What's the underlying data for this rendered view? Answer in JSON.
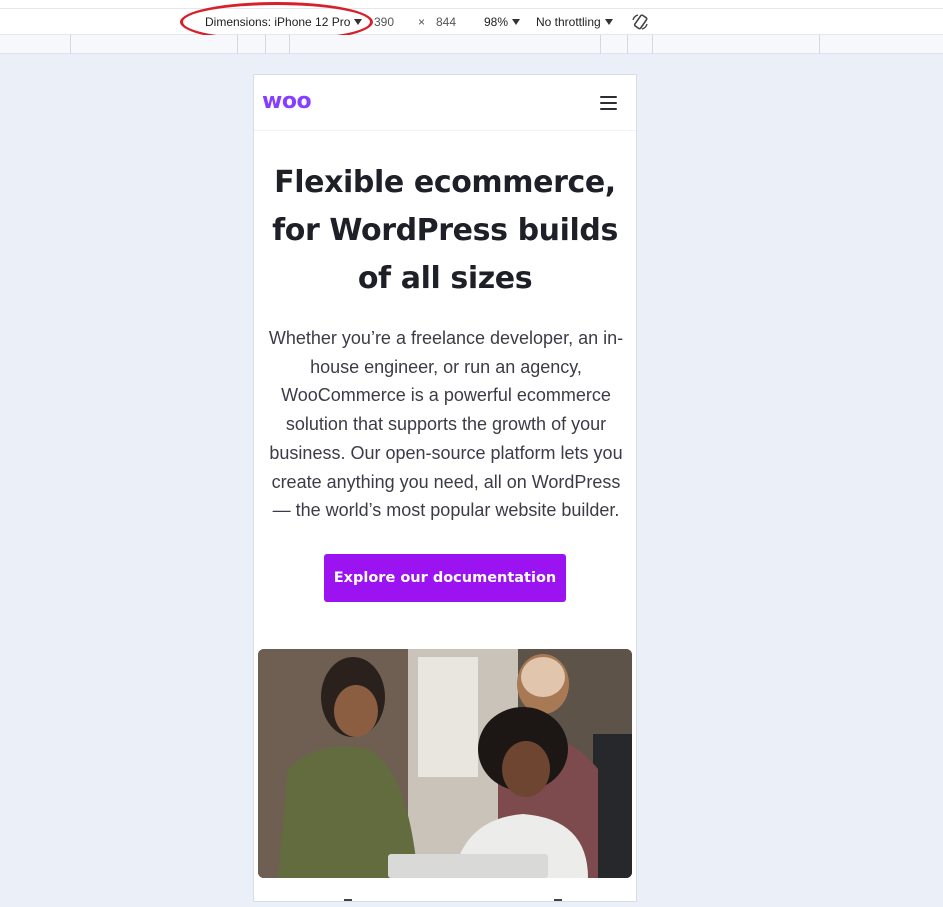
{
  "devtools": {
    "dimensions_label": "Dimensions: iPhone 12 Pro",
    "width": "390",
    "times": "×",
    "height": "844",
    "zoom": "98%",
    "throttling": "No throttling"
  },
  "site": {
    "logo": "woo",
    "hero_title": "Flexible ecommerce, for WordPress builds of all sizes",
    "hero_text": "Whether you’re a freelance developer, an in-house engineer, or run an agency, WooCommerce is a powerful ecommerce solution that supports the growth of your business. Our open-source platform lets you create anything you need, all on WordPress — the world’s most popular website builder.",
    "cta_label": "Explore our documentation"
  },
  "colors": {
    "brand": "#873eff",
    "cta": "#9b13f0",
    "highlight": "#d8202a",
    "canvas": "#ebeff7"
  },
  "icons": {
    "dropdown": "caret-down-icon",
    "rotate": "rotate-icon",
    "menu": "hamburger-menu-icon"
  }
}
